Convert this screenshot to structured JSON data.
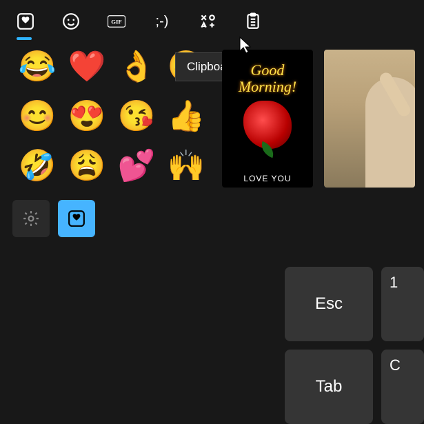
{
  "tabs": {
    "favorites_name": "favorites",
    "emoji_name": "emoji",
    "gif_label": "GIF",
    "kaomoji_label": ";-)",
    "symbols_name": "symbols",
    "clipboard_name": "clipboard-history"
  },
  "tooltip": {
    "text": "Clipboard history"
  },
  "emoji": {
    "grid": [
      "😂",
      "❤️",
      "👌",
      "😃",
      "😊",
      "😍",
      "😘",
      "👍",
      "🤣",
      "😩",
      "💕",
      "🙌"
    ]
  },
  "gifs": {
    "card1_line1": "Good",
    "card1_line2": "Morning!",
    "card1_caption": "LOVE YOU"
  },
  "tools": {
    "settings_name": "settings",
    "favorites_name": "favorites"
  },
  "keyboard": {
    "esc": "Esc",
    "one": "1",
    "tab": "Tab",
    "q_hint": "C"
  }
}
